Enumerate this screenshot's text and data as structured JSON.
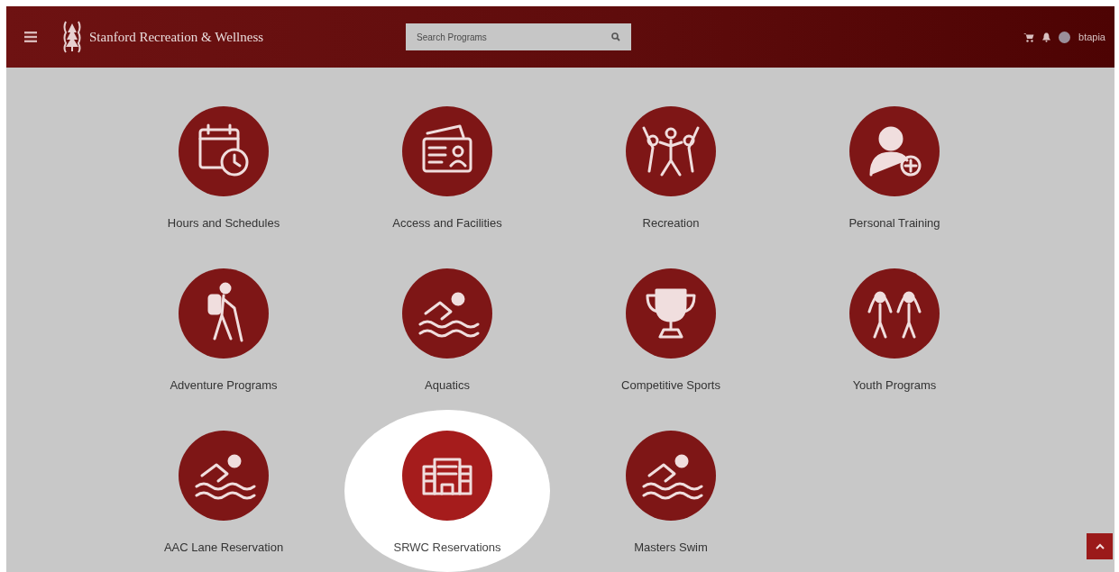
{
  "header": {
    "title": "Stanford Recreation & Wellness",
    "search": {
      "placeholder": "Search Programs"
    },
    "user": "btapia"
  },
  "programs": [
    {
      "label": "Hours and Schedules",
      "kind": "calendar",
      "selected": false
    },
    {
      "label": "Access and Facilities",
      "kind": "card",
      "selected": false
    },
    {
      "label": "Recreation",
      "kind": "people",
      "selected": false
    },
    {
      "label": "Personal Training",
      "kind": "person",
      "selected": false
    },
    {
      "label": "Adventure Programs",
      "kind": "hiker",
      "selected": false
    },
    {
      "label": "Aquatics",
      "kind": "swim",
      "selected": false
    },
    {
      "label": "Competitive Sports",
      "kind": "trophy",
      "selected": false
    },
    {
      "label": "Youth Programs",
      "kind": "kids",
      "selected": false
    },
    {
      "label": "AAC Lane Reservation",
      "kind": "swimmer",
      "selected": false
    },
    {
      "label": "SRWC Reservations",
      "kind": "building",
      "selected": true
    },
    {
      "label": "Masters Swim",
      "kind": "swimmer",
      "selected": false
    }
  ]
}
